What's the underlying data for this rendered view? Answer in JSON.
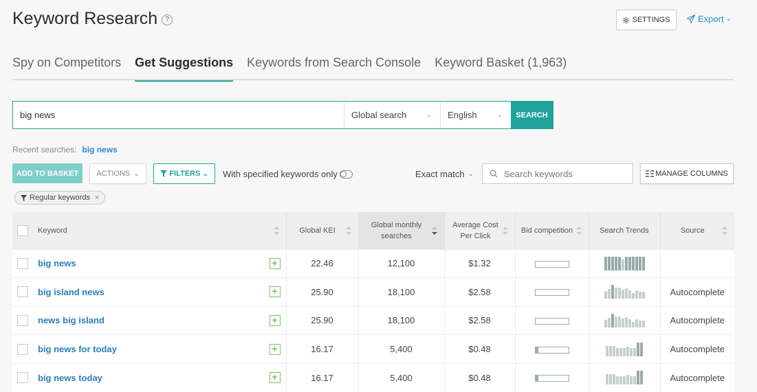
{
  "header": {
    "title": "Keyword Research",
    "help_icon": "question-circle-icon",
    "settings_label": "SETTINGS",
    "export_label": "Export"
  },
  "tabs": [
    {
      "label": "Spy on Competitors",
      "active": false
    },
    {
      "label": "Get Suggestions",
      "active": true
    },
    {
      "label": "Keywords from Search Console",
      "active": false
    },
    {
      "label": "Keyword Basket (1,963)",
      "active": false
    }
  ],
  "search": {
    "value": "big news",
    "region": "Global search",
    "language": "English",
    "button": "SEARCH"
  },
  "recent": {
    "label": "Recent searches:",
    "items": [
      "big news"
    ]
  },
  "toolbar": {
    "add_to_basket": "ADD TO BASKET",
    "actions": "ACTIONS",
    "filters": "FILTERS",
    "with_specified": "With specified keywords only",
    "with_specified_on": false,
    "match_type": "Exact match",
    "search_placeholder": "Search keywords",
    "manage_columns": "MANAGE COLUMNS"
  },
  "active_filters": [
    {
      "label": "Regular keywords"
    }
  ],
  "table": {
    "columns": [
      "Keyword",
      "Global KEI",
      "Global monthly searches",
      "Average Cost Per Click",
      "Bid competition",
      "Search Trends",
      "Source"
    ],
    "sorted_column": "Global monthly searches",
    "rows": [
      {
        "keyword": "big news",
        "kei": "22.46",
        "searches": "12,100",
        "cpc": "$1.32",
        "bid": 0.0,
        "trend": [
          1,
          1,
          1,
          1,
          1,
          0.8,
          1,
          1,
          1,
          1,
          1,
          1
        ],
        "trend_dark": [
          1,
          1,
          1,
          1,
          1,
          0,
          1,
          1,
          1,
          1,
          1,
          1
        ],
        "source": ""
      },
      {
        "keyword": "big island news",
        "kei": "25.90",
        "searches": "18,100",
        "cpc": "$2.58",
        "bid": 0.0,
        "trend": [
          0.55,
          0.7,
          1,
          0.8,
          0.8,
          0.65,
          0.75,
          0.6,
          0.4,
          0.6,
          0.5,
          0.5
        ],
        "trend_dark": [
          0,
          0,
          1,
          0,
          0,
          0,
          0,
          0,
          0,
          0,
          0,
          0
        ],
        "source": "Autocomplete"
      },
      {
        "keyword": "news big island",
        "kei": "25.90",
        "searches": "18,100",
        "cpc": "$2.58",
        "bid": 0.0,
        "trend": [
          0.55,
          0.7,
          1,
          0.8,
          0.8,
          0.65,
          0.75,
          0.6,
          0.4,
          0.6,
          0.5,
          0.5
        ],
        "trend_dark": [
          0,
          0,
          1,
          0,
          0,
          0,
          0,
          0,
          0,
          0,
          0,
          0
        ],
        "source": "Autocomplete"
      },
      {
        "keyword": "big news for today",
        "kei": "16.17",
        "searches": "5,400",
        "cpc": "$0.48",
        "bid": 0.05,
        "trend": [
          0.75,
          0.75,
          0.75,
          0.6,
          0.6,
          0.6,
          0.7,
          0.6,
          0.6,
          1,
          1
        ],
        "trend_dark": [
          0,
          0,
          0,
          0,
          0,
          0,
          0,
          0,
          0,
          1,
          1
        ],
        "source": "Autocomplete"
      },
      {
        "keyword": "big news today",
        "kei": "16.17",
        "searches": "5,400",
        "cpc": "$0.48",
        "bid": 0.05,
        "trend": [
          0.75,
          0.75,
          0.75,
          0.6,
          0.6,
          0.6,
          0.7,
          0.6,
          0.6,
          1,
          1
        ],
        "trend_dark": [
          0,
          0,
          0,
          0,
          0,
          0,
          0,
          0,
          0,
          1,
          1
        ],
        "source": "Autocomplete"
      }
    ]
  },
  "colors": {
    "accent": "#1fa39a",
    "link": "#2b7fba",
    "add_basket_bg": "#80ceca",
    "plus_green": "#7cbf6a"
  }
}
